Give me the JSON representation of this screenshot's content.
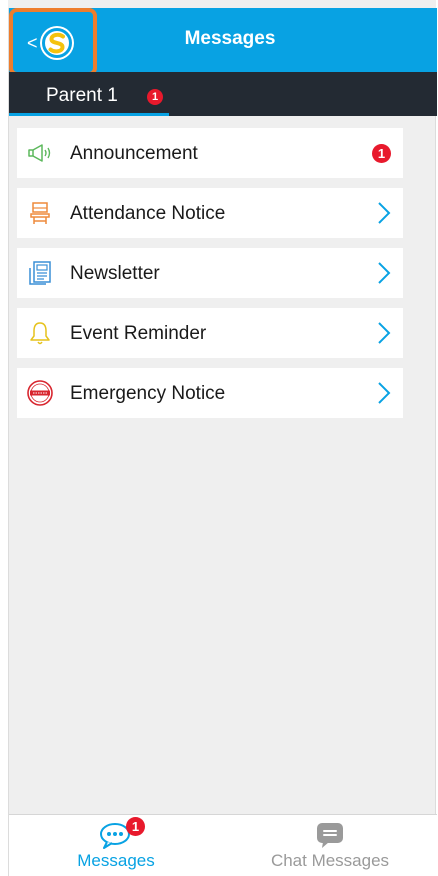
{
  "header": {
    "title": "Messages",
    "back_chevron": "<"
  },
  "tabs": [
    {
      "label": "Parent 1",
      "badge": "1",
      "active": true
    }
  ],
  "list": {
    "items": [
      {
        "label": "Announcement",
        "icon": "megaphone-icon",
        "badge": "1"
      },
      {
        "label": "Attendance Notice",
        "icon": "chair-icon"
      },
      {
        "label": "Newsletter",
        "icon": "newspaper-icon"
      },
      {
        "label": "Event Reminder",
        "icon": "bell-icon"
      },
      {
        "label": "Emergency Notice",
        "icon": "urgent-stamp-icon"
      }
    ]
  },
  "bottom_nav": {
    "items": [
      {
        "label": "Messages",
        "icon": "message-bubble-icon",
        "badge": "1",
        "active": true
      },
      {
        "label": "Chat Messages",
        "icon": "chat-icon",
        "active": false
      }
    ]
  },
  "colors": {
    "accent": "#08a2e3",
    "tabbar": "#232a33",
    "badge": "#e8192c",
    "highlight": "#ee7d2c",
    "inactive": "#9a9a9a"
  }
}
